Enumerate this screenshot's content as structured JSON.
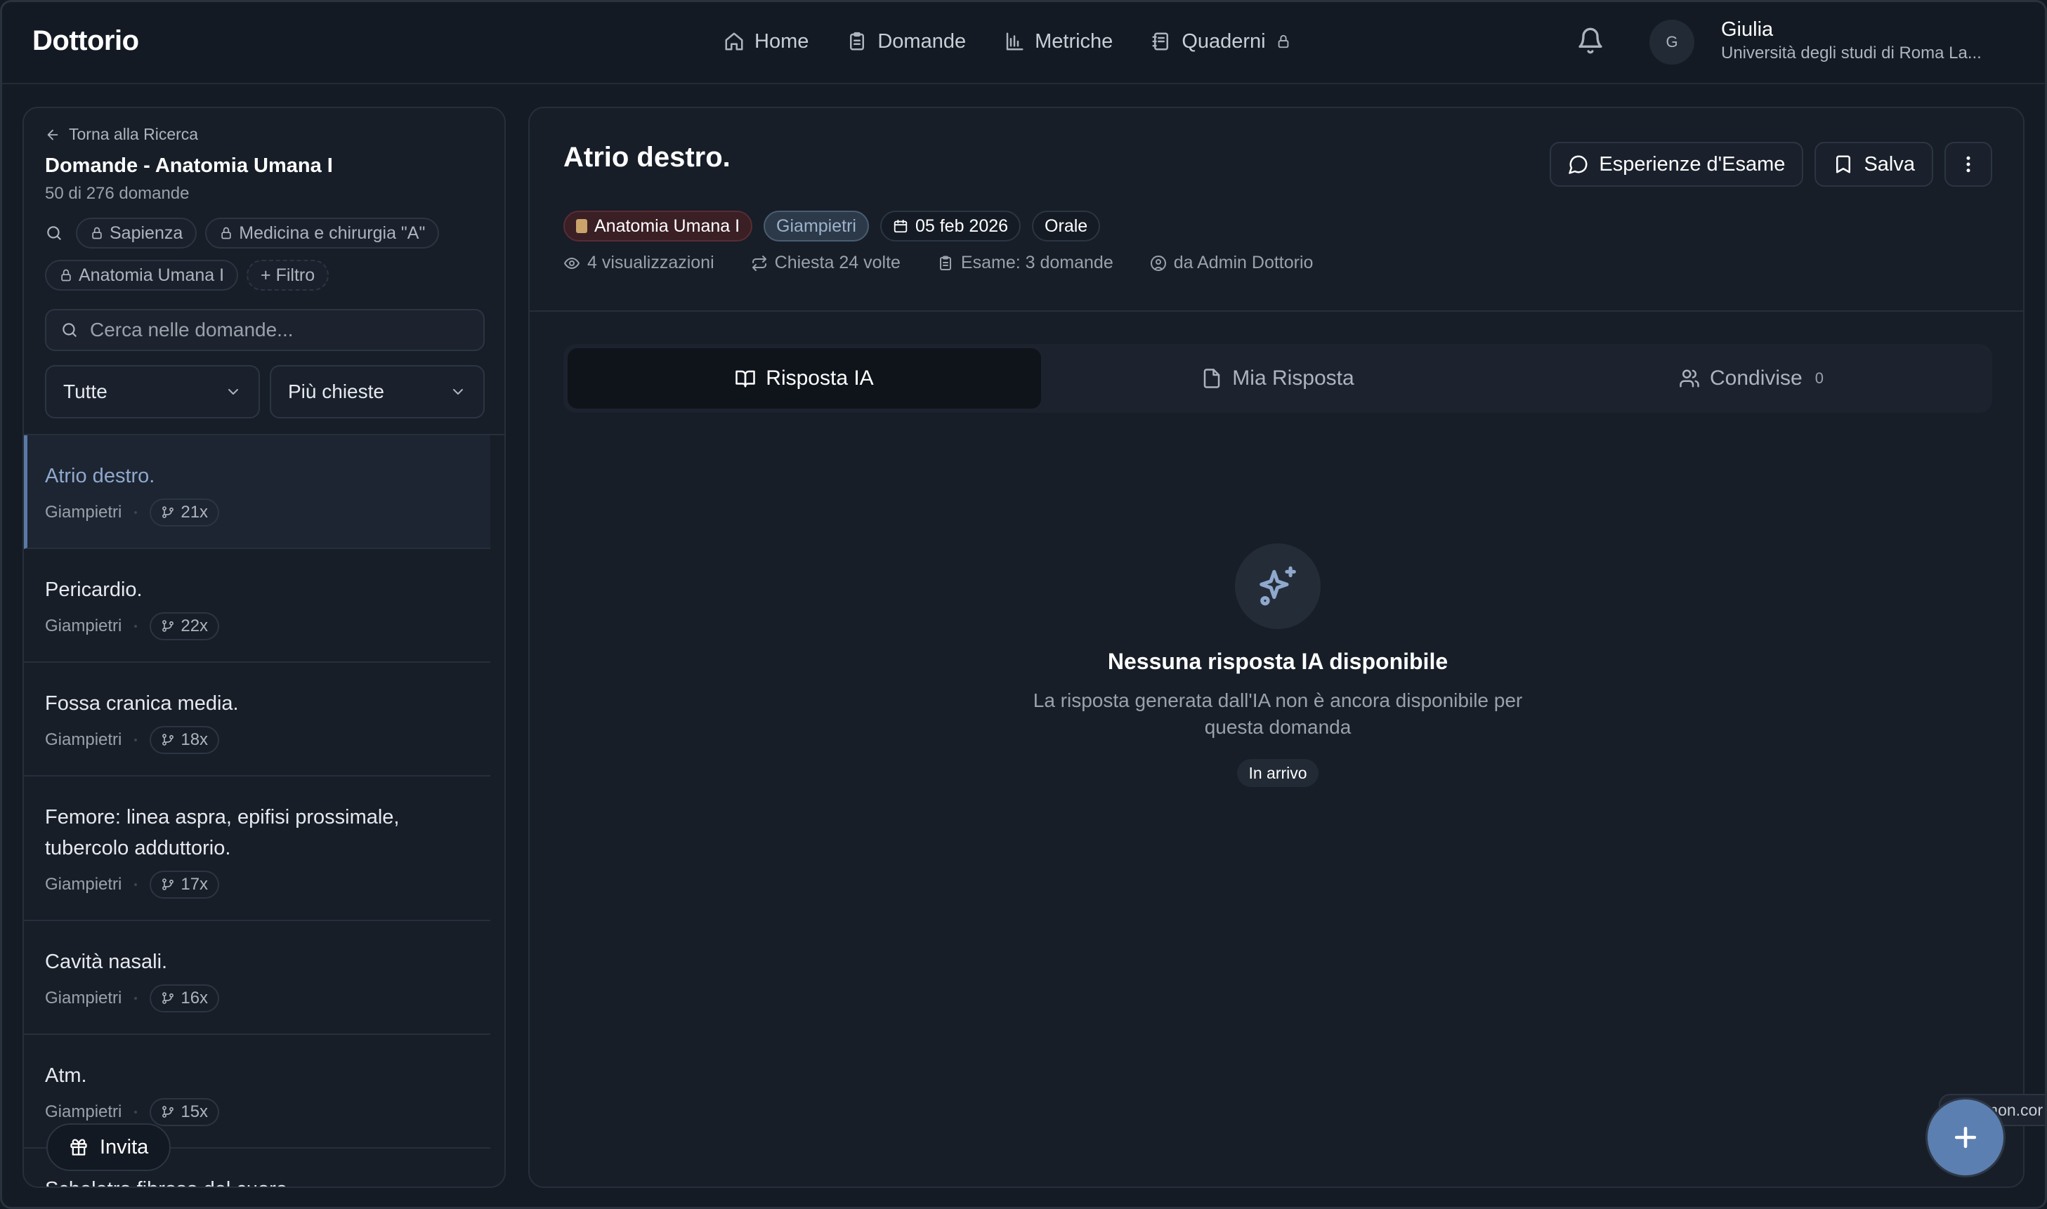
{
  "app": {
    "logo": "Dottorio"
  },
  "nav": {
    "items": [
      {
        "label": "Home",
        "icon": "home-icon"
      },
      {
        "label": "Domande",
        "icon": "clipboard-icon"
      },
      {
        "label": "Metriche",
        "icon": "bar-chart-icon"
      },
      {
        "label": "Quaderni",
        "icon": "notebook-icon"
      }
    ]
  },
  "user": {
    "initial": "G",
    "name": "Giulia",
    "university": "Università degli studi di Roma La..."
  },
  "left": {
    "back": "Torna alla Ricerca",
    "title": "Domande - Anatomia Umana I",
    "count": "50 di 276 domande",
    "filters": [
      "Sapienza",
      "Medicina e chirurgia \"A\"",
      "Anatomia Umana I"
    ],
    "add_filter": "+ Filtro",
    "search_placeholder": "Cerca nelle domande...",
    "select_type": "Tutte",
    "select_sort": "Più chieste",
    "questions": [
      {
        "text": "Atrio destro.",
        "prof": "Giampietri",
        "count": "21x"
      },
      {
        "text": "Pericardio.",
        "prof": "Giampietri",
        "count": "22x"
      },
      {
        "text": "Fossa cranica media.",
        "prof": "Giampietri",
        "count": "18x"
      },
      {
        "text": "Femore: linea aspra, epifisi prossimale, tubercolo adduttorio.",
        "prof": "Giampietri",
        "count": "17x"
      },
      {
        "text": "Cavità nasali.",
        "prof": "Giampietri",
        "count": "16x"
      },
      {
        "text": "Atm.",
        "prof": "Giampietri",
        "count": "15x"
      },
      {
        "text": "Scheletro fibroso del cuore.",
        "prof": "",
        "count": ""
      }
    ],
    "invite": "Invita"
  },
  "main": {
    "title": "Atrio destro.",
    "buttons": {
      "experiences": "Esperienze d'Esame",
      "save": "Salva"
    },
    "tags": {
      "course": "Anatomia Umana I",
      "prof": "Giampietri",
      "date": "05 feb 2026",
      "type": "Orale"
    },
    "meta": {
      "views": "4 visualizzazioni",
      "asked": "Chiesta 24 volte",
      "exam": "Esame: 3 domande",
      "author": "da Admin Dottorio"
    },
    "tabs": [
      {
        "label": "Risposta IA",
        "badge": ""
      },
      {
        "label": "Mia Risposta",
        "badge": ""
      },
      {
        "label": "Condivise",
        "badge": "0"
      }
    ],
    "empty": {
      "title": "Nessuna risposta IA disponibile",
      "desc": "La risposta generata dall'IA non è ancora disponibile per questa domanda",
      "badge": "In arrivo"
    }
  },
  "edge_chip": "mon.cor",
  "colors": {
    "accent": "#5b7fb0",
    "active_question": "#8fa8cc",
    "background": "#151b24"
  }
}
